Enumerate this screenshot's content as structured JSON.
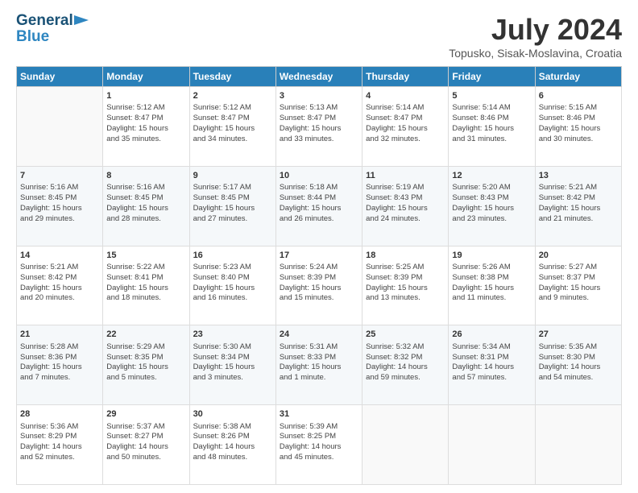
{
  "header": {
    "logo_line1": "General",
    "logo_line2": "Blue",
    "title": "July 2024",
    "location": "Topusko, Sisak-Moslavina, Croatia"
  },
  "days_of_week": [
    "Sunday",
    "Monday",
    "Tuesday",
    "Wednesday",
    "Thursday",
    "Friday",
    "Saturday"
  ],
  "weeks": [
    [
      {
        "day": "",
        "content": ""
      },
      {
        "day": "1",
        "content": "Sunrise: 5:12 AM\nSunset: 8:47 PM\nDaylight: 15 hours\nand 35 minutes."
      },
      {
        "day": "2",
        "content": "Sunrise: 5:12 AM\nSunset: 8:47 PM\nDaylight: 15 hours\nand 34 minutes."
      },
      {
        "day": "3",
        "content": "Sunrise: 5:13 AM\nSunset: 8:47 PM\nDaylight: 15 hours\nand 33 minutes."
      },
      {
        "day": "4",
        "content": "Sunrise: 5:14 AM\nSunset: 8:47 PM\nDaylight: 15 hours\nand 32 minutes."
      },
      {
        "day": "5",
        "content": "Sunrise: 5:14 AM\nSunset: 8:46 PM\nDaylight: 15 hours\nand 31 minutes."
      },
      {
        "day": "6",
        "content": "Sunrise: 5:15 AM\nSunset: 8:46 PM\nDaylight: 15 hours\nand 30 minutes."
      }
    ],
    [
      {
        "day": "7",
        "content": "Sunrise: 5:16 AM\nSunset: 8:45 PM\nDaylight: 15 hours\nand 29 minutes."
      },
      {
        "day": "8",
        "content": "Sunrise: 5:16 AM\nSunset: 8:45 PM\nDaylight: 15 hours\nand 28 minutes."
      },
      {
        "day": "9",
        "content": "Sunrise: 5:17 AM\nSunset: 8:45 PM\nDaylight: 15 hours\nand 27 minutes."
      },
      {
        "day": "10",
        "content": "Sunrise: 5:18 AM\nSunset: 8:44 PM\nDaylight: 15 hours\nand 26 minutes."
      },
      {
        "day": "11",
        "content": "Sunrise: 5:19 AM\nSunset: 8:43 PM\nDaylight: 15 hours\nand 24 minutes."
      },
      {
        "day": "12",
        "content": "Sunrise: 5:20 AM\nSunset: 8:43 PM\nDaylight: 15 hours\nand 23 minutes."
      },
      {
        "day": "13",
        "content": "Sunrise: 5:21 AM\nSunset: 8:42 PM\nDaylight: 15 hours\nand 21 minutes."
      }
    ],
    [
      {
        "day": "14",
        "content": "Sunrise: 5:21 AM\nSunset: 8:42 PM\nDaylight: 15 hours\nand 20 minutes."
      },
      {
        "day": "15",
        "content": "Sunrise: 5:22 AM\nSunset: 8:41 PM\nDaylight: 15 hours\nand 18 minutes."
      },
      {
        "day": "16",
        "content": "Sunrise: 5:23 AM\nSunset: 8:40 PM\nDaylight: 15 hours\nand 16 minutes."
      },
      {
        "day": "17",
        "content": "Sunrise: 5:24 AM\nSunset: 8:39 PM\nDaylight: 15 hours\nand 15 minutes."
      },
      {
        "day": "18",
        "content": "Sunrise: 5:25 AM\nSunset: 8:39 PM\nDaylight: 15 hours\nand 13 minutes."
      },
      {
        "day": "19",
        "content": "Sunrise: 5:26 AM\nSunset: 8:38 PM\nDaylight: 15 hours\nand 11 minutes."
      },
      {
        "day": "20",
        "content": "Sunrise: 5:27 AM\nSunset: 8:37 PM\nDaylight: 15 hours\nand 9 minutes."
      }
    ],
    [
      {
        "day": "21",
        "content": "Sunrise: 5:28 AM\nSunset: 8:36 PM\nDaylight: 15 hours\nand 7 minutes."
      },
      {
        "day": "22",
        "content": "Sunrise: 5:29 AM\nSunset: 8:35 PM\nDaylight: 15 hours\nand 5 minutes."
      },
      {
        "day": "23",
        "content": "Sunrise: 5:30 AM\nSunset: 8:34 PM\nDaylight: 15 hours\nand 3 minutes."
      },
      {
        "day": "24",
        "content": "Sunrise: 5:31 AM\nSunset: 8:33 PM\nDaylight: 15 hours\nand 1 minute."
      },
      {
        "day": "25",
        "content": "Sunrise: 5:32 AM\nSunset: 8:32 PM\nDaylight: 14 hours\nand 59 minutes."
      },
      {
        "day": "26",
        "content": "Sunrise: 5:34 AM\nSunset: 8:31 PM\nDaylight: 14 hours\nand 57 minutes."
      },
      {
        "day": "27",
        "content": "Sunrise: 5:35 AM\nSunset: 8:30 PM\nDaylight: 14 hours\nand 54 minutes."
      }
    ],
    [
      {
        "day": "28",
        "content": "Sunrise: 5:36 AM\nSunset: 8:29 PM\nDaylight: 14 hours\nand 52 minutes."
      },
      {
        "day": "29",
        "content": "Sunrise: 5:37 AM\nSunset: 8:27 PM\nDaylight: 14 hours\nand 50 minutes."
      },
      {
        "day": "30",
        "content": "Sunrise: 5:38 AM\nSunset: 8:26 PM\nDaylight: 14 hours\nand 48 minutes."
      },
      {
        "day": "31",
        "content": "Sunrise: 5:39 AM\nSunset: 8:25 PM\nDaylight: 14 hours\nand 45 minutes."
      },
      {
        "day": "",
        "content": ""
      },
      {
        "day": "",
        "content": ""
      },
      {
        "day": "",
        "content": ""
      }
    ]
  ]
}
